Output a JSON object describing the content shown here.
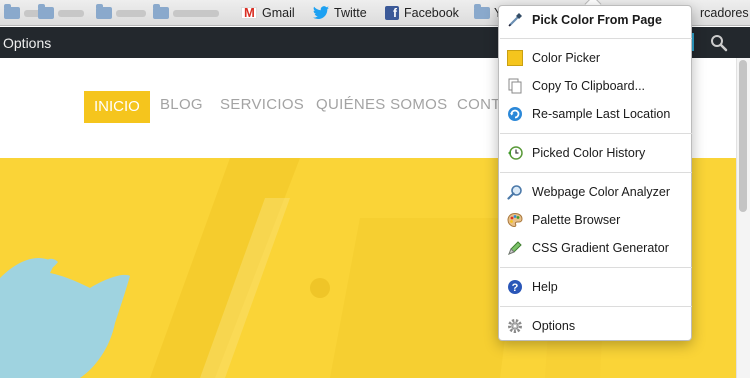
{
  "bookmarks": {
    "items": [
      {
        "label": "Gmail",
        "icon": "gmail-icon"
      },
      {
        "label": "Twitte",
        "icon": "twitter-icon"
      },
      {
        "label": "Facebook",
        "icon": "facebook-icon"
      },
      {
        "label": "Y",
        "icon": "folder-icon"
      }
    ],
    "overflow_label": "rcadores"
  },
  "admin_bar": {
    "options_label": "Options",
    "search_icon": "search-icon"
  },
  "site_nav": {
    "items": [
      {
        "label": "INICIO",
        "active": true
      },
      {
        "label": "BLOG"
      },
      {
        "label": "SERVICIOS"
      },
      {
        "label": "QUIÉNES SOMOS"
      },
      {
        "label": "CONTA"
      }
    ],
    "accent_color": "#f5c51d",
    "hero_color": "#fad437"
  },
  "menu": {
    "items": [
      {
        "label": "Pick Color From Page",
        "icon": "eyedropper-icon",
        "bold": true
      },
      {
        "label": "Color Picker",
        "icon": "color-swatch-icon"
      },
      {
        "label": "Copy To Clipboard...",
        "icon": "clipboard-icon"
      },
      {
        "label": "Re-sample Last Location",
        "icon": "resample-icon"
      },
      {
        "label": "Picked Color History",
        "icon": "history-icon"
      },
      {
        "label": "Webpage Color Analyzer",
        "icon": "magnifier-icon"
      },
      {
        "label": "Palette Browser",
        "icon": "palette-icon"
      },
      {
        "label": "CSS Gradient Generator",
        "icon": "gradient-pen-icon"
      },
      {
        "label": "Help",
        "icon": "help-icon"
      },
      {
        "label": "Options",
        "icon": "gear-icon"
      }
    ]
  }
}
